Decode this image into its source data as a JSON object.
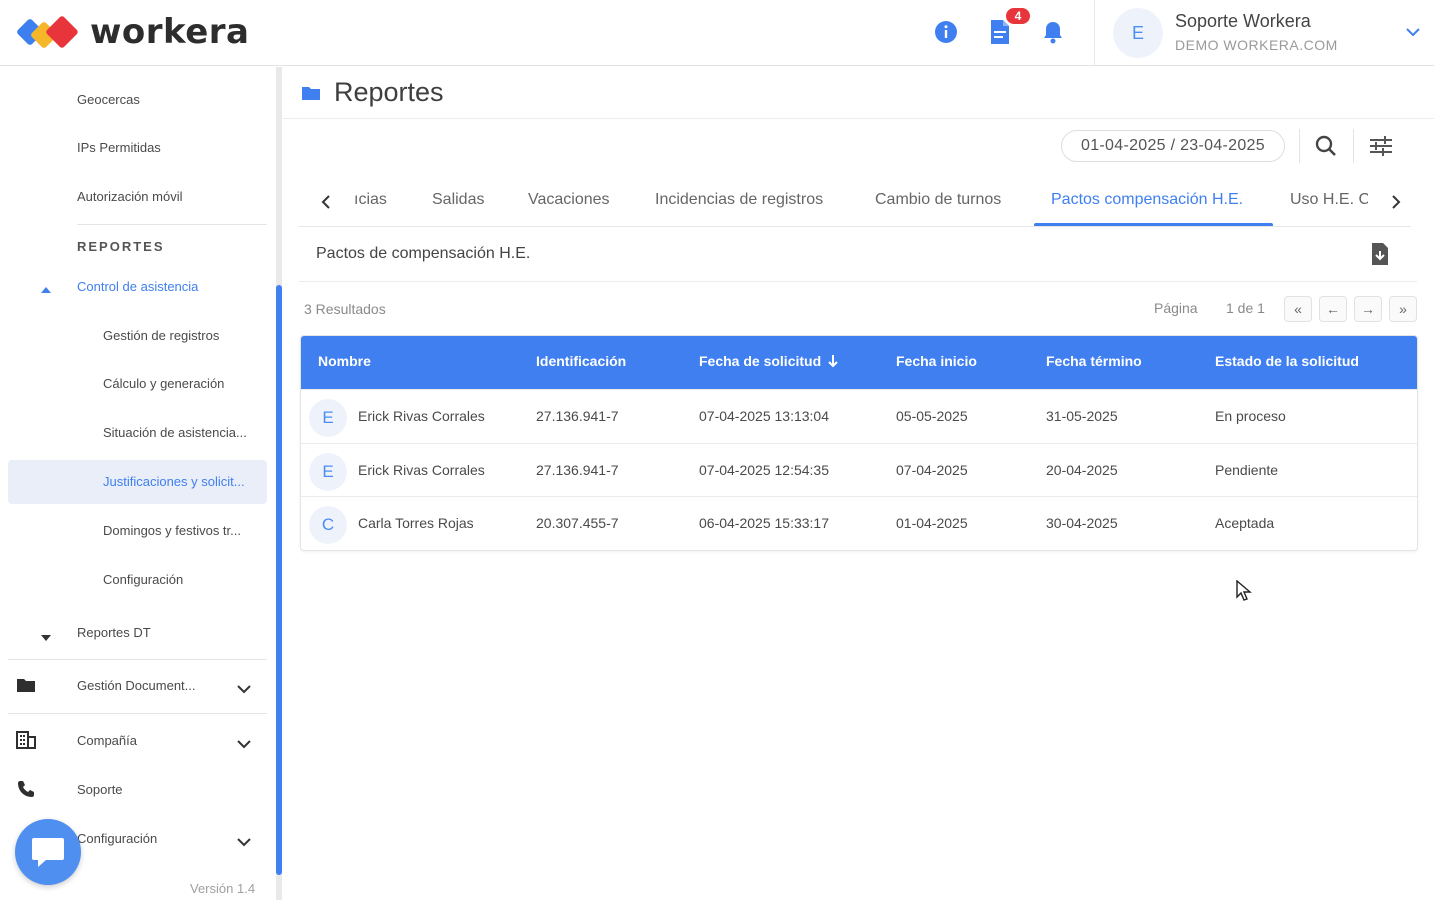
{
  "header": {
    "logo_text": "workera",
    "notifications_badge": "4",
    "user": {
      "initial": "E",
      "name": "Soporte Workera",
      "company": "DEMO WORKERA.COM"
    },
    "colors": {
      "accent": "#3f7fef",
      "badge": "#e8343b"
    }
  },
  "sidebar": {
    "items": {
      "geocercas": "Geocercas",
      "ips": "IPs Permitidas",
      "autorizacion": "Autorización móvil"
    },
    "section_reportes": "REPORTES",
    "control_asistencia": "Control de asistencia",
    "sub_items": {
      "gestion": "Gestión de registros",
      "calculo": "Cálculo y generación",
      "situacion": "Situación de asistencia...",
      "justificaciones": "Justificaciones y solicit...",
      "domingos": "Domingos y festivos tr...",
      "configuracion": "Configuración"
    },
    "reportes_dt": "Reportes DT",
    "gestion_documental": "Gestión Document...",
    "compania": "Compañía",
    "soporte": "Soporte",
    "configuracion": "Configuración",
    "version": "Versión 1.4"
  },
  "main": {
    "title": "Reportes",
    "date_range": "01-04-2025 / 23-04-2025",
    "tabs": {
      "t0": "ıcias",
      "t1": "Salidas",
      "t2": "Vacaciones",
      "t3": "Incidencias de registros",
      "t4": "Cambio de turnos",
      "t5": "Pactos compensación H.E.",
      "t6": "Uso H.E. Co"
    },
    "subtitle": "Pactos de compensación H.E.",
    "results": "3 Resultados",
    "pagination": {
      "label": "Página",
      "count": "1 de 1",
      "first": "«",
      "prev": "←",
      "next": "→",
      "last": "»"
    },
    "table": {
      "headers": {
        "nombre": "Nombre",
        "identificacion": "Identificación",
        "fecha_solicitud": "Fecha de solicitud",
        "fecha_inicio": "Fecha inicio",
        "fecha_termino": "Fecha término",
        "estado": "Estado de la solicitud"
      },
      "rows": [
        {
          "initial": "E",
          "nombre": "Erick Rivas Corrales",
          "id": "27.136.941-7",
          "solicitud": "07-04-2025 13:13:04",
          "inicio": "05-05-2025",
          "termino": "31-05-2025",
          "estado": "En proceso"
        },
        {
          "initial": "E",
          "nombre": "Erick Rivas Corrales",
          "id": "27.136.941-7",
          "solicitud": "07-04-2025 12:54:35",
          "inicio": "07-04-2025",
          "termino": "20-04-2025",
          "estado": "Pendiente"
        },
        {
          "initial": "C",
          "nombre": "Carla Torres Rojas",
          "id": "20.307.455-7",
          "solicitud": "06-04-2025 15:33:17",
          "inicio": "01-04-2025",
          "termino": "30-04-2025",
          "estado": "Aceptada"
        }
      ]
    }
  }
}
